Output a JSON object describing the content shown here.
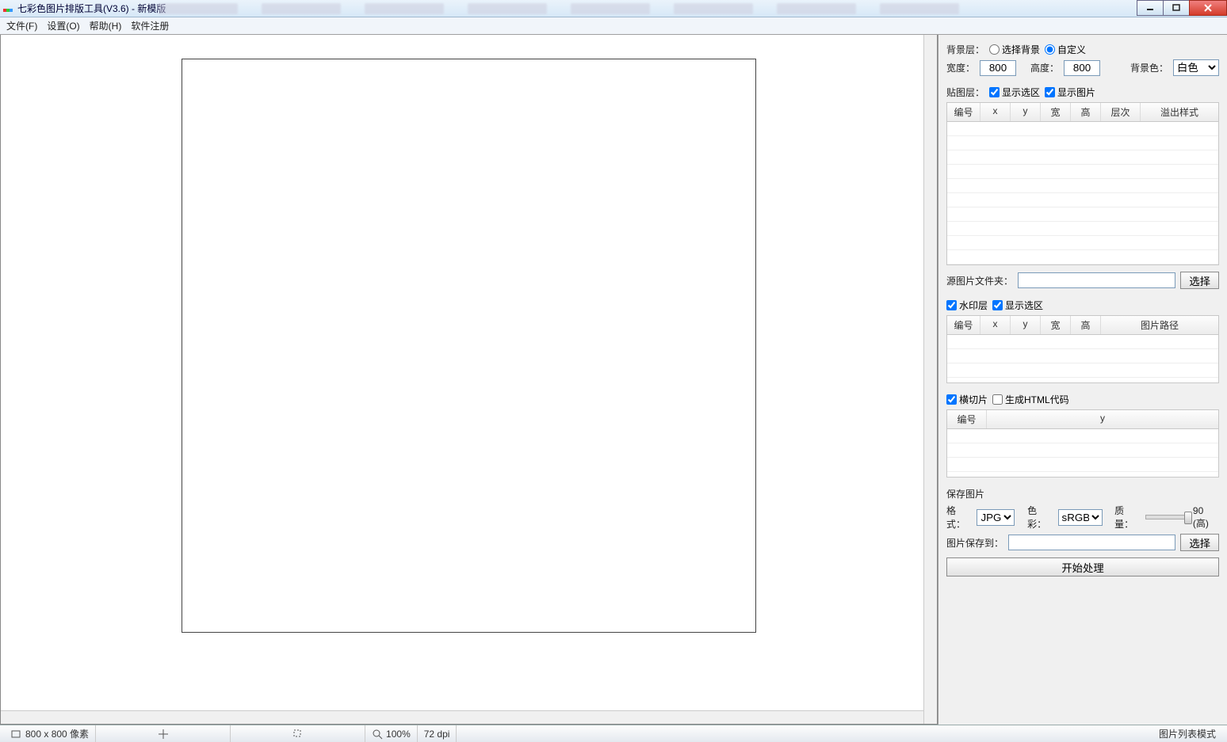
{
  "window": {
    "title": "七彩色图片排版工具(V3.6) - 新模版"
  },
  "menu": {
    "file": "文件(F)",
    "settings": "设置(O)",
    "help": "帮助(H)",
    "register": "软件注册"
  },
  "panel": {
    "bgLayerLabel": "背景层：",
    "radioSelectBg": "选择背景",
    "radioCustom": "自定义",
    "widthLabel": "宽度：",
    "widthValue": "800",
    "heightLabel": "高度：",
    "heightValue": "800",
    "bgColorLabel": "背景色：",
    "bgColorValue": "白色",
    "pasteLayerLabel": "贴图层：",
    "showSelection": "显示选区",
    "showImage": "显示图片",
    "table1": {
      "cols": [
        "编号",
        "x",
        "y",
        "宽",
        "高",
        "层次",
        "溢出样式"
      ]
    },
    "srcFolderLabel": "源图片文件夹：",
    "selectBtn": "选择",
    "watermarkLayer": "水印层",
    "showSelection2": "显示选区",
    "table2": {
      "cols": [
        "编号",
        "x",
        "y",
        "宽",
        "高",
        "图片路径"
      ]
    },
    "hcut": "横切片",
    "genHtml": "生成HTML代码",
    "table3": {
      "cols": [
        "编号",
        "y"
      ]
    },
    "saveImgTitle": "保存图片",
    "formatLabel": "格式：",
    "formatValue": "JPG",
    "colorLabel": "色彩：",
    "colorValue": "sRGB",
    "qualityLabel": "质量：",
    "qualityValue": "90 (高)",
    "saveToLabel": "图片保存到：",
    "startBtn": "开始处理"
  },
  "status": {
    "size": "800 x 800 像素",
    "zoom": "100%",
    "dpi": "72 dpi",
    "mode": "图片列表模式"
  }
}
